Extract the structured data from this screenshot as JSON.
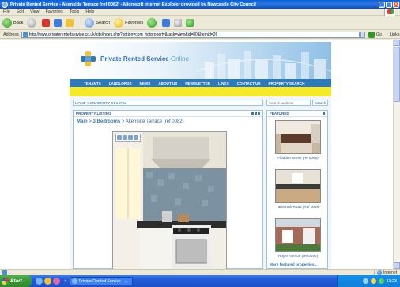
{
  "window": {
    "title": "Private Rented Service - Akenside Terrace (ref 0082) - Microsoft Internet Explorer provided by Newcastle City Council"
  },
  "menu": {
    "items": [
      "File",
      "Edit",
      "View",
      "Favorites",
      "Tools",
      "Help"
    ]
  },
  "toolbar": {
    "back": "Back",
    "search": "Search",
    "favorites": "Favorites"
  },
  "address": {
    "label": "Address",
    "url": "http://www.privaterentedservice.co.uk/site/index.php?option=com_hotproperty&task=view&id=80&Itemid=26",
    "go": "Go",
    "links": "Links"
  },
  "site": {
    "brand": "Private Rented Service",
    "brand_suffix": "Online",
    "nav": [
      "TENANTS",
      "LANDLORDS",
      "NEWS",
      "ABOUT US",
      "NEWSLETTER",
      "LINKS",
      "CONTACT US",
      "PROPERTY SEARCH"
    ],
    "breadcrumb": "HOME > PROPERTY SEARCH",
    "search_placeholder": "Search website",
    "search_button": "Search",
    "listing_header": "PROPERTY LISTING",
    "listing_crumb_main": "Main",
    "listing_crumb_sep1": " > ",
    "listing_crumb_bedrooms": "3 Bedrooms",
    "listing_crumb_sep2": " > ",
    "listing_crumb_property": "Akenside Terrace (ref 0082)",
    "featured_header": "FEATURED",
    "featured": [
      {
        "caption": "Flodden Street (ref 0096)"
      },
      {
        "caption": "Tamworth Road (Ref 0098)"
      },
      {
        "caption": "Hoyle Avenue (Ref0090)"
      }
    ],
    "more_featured": "More featured properties..."
  },
  "status": {
    "zone": "Internet"
  },
  "taskbar": {
    "start": "Start",
    "task": "Private Rented Service - ...",
    "clock": "11:23"
  }
}
